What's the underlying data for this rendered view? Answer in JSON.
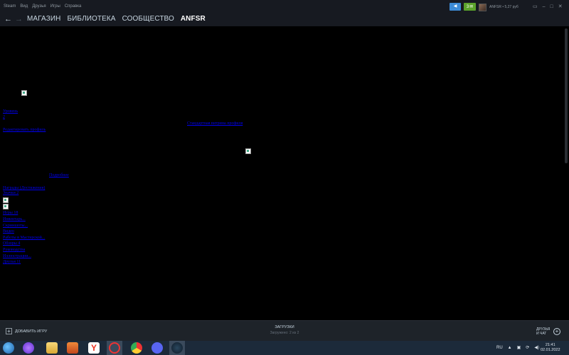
{
  "menubar": {
    "items": [
      "Steam",
      "Вид",
      "Друзья",
      "Игры",
      "Справка"
    ],
    "notif_count": "3",
    "account_name": "ANFSR",
    "balance": "5,27 руб",
    "account_text": "ANFSR • 5,27 руб"
  },
  "nav": {
    "items": [
      "МАГАЗИН",
      "БИБЛИОТЕКА",
      "СООБЩЕСТВО",
      "ANFSR"
    ]
  },
  "main": {
    "links": [
      "Уровень",
      "2",
      "Редактировать профиль",
      "Стандартная витрина профиля",
      "Подробнее",
      "Награды (Достижения)",
      "Значки 2",
      "Игры 18",
      "Инвентарь...",
      "Скриншоты...",
      "Видео",
      "Работы в Мастерской...",
      "Обзоры 4",
      "Руководства",
      "Иллюстрации...",
      "Друзья 11"
    ]
  },
  "bottombar": {
    "add_game": "ДОБАВИТЬ ИГРУ",
    "downloads_title": "ЗАГРУЗКИ",
    "downloads_status": "Загружено: 2 из 2",
    "friends_chat": "ДРУЗЬЯ И ЧАТ"
  },
  "taskbar": {
    "lang": "RU",
    "time": "21:41",
    "date": "02.01.2022",
    "icons": [
      "start-orb",
      "alice-icon",
      "file-explorer-icon",
      "media-player-icon",
      "yandex-browser-icon",
      "opera-icon",
      "chrome-icon",
      "discord-icon",
      "steam-icon"
    ]
  },
  "colors": {
    "steam_dark": "#171a21",
    "link_blue": "#0000ee",
    "announce_blue": "#3d8bd6",
    "notif_green": "#5ba32b"
  }
}
